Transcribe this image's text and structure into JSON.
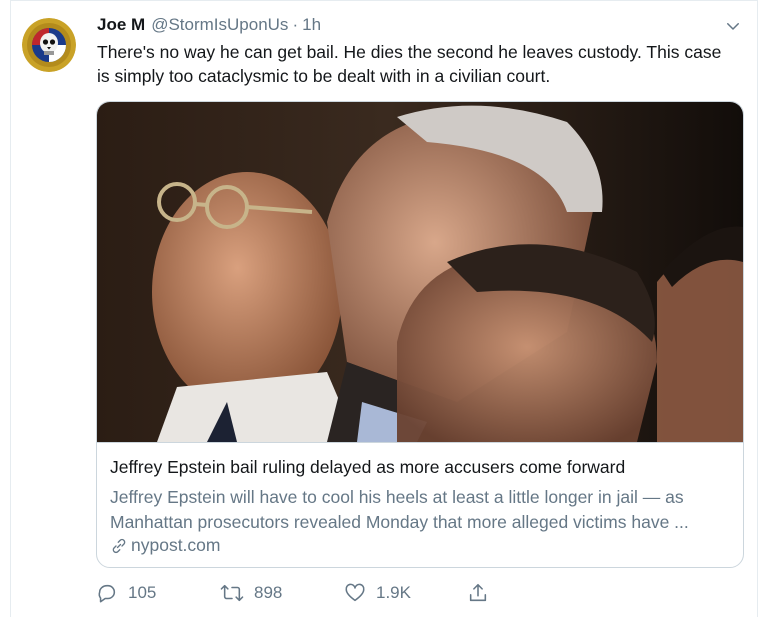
{
  "tweet": {
    "display_name": "Joe M",
    "handle": "@StormIsUponUs",
    "separator": "·",
    "time": "1h",
    "text": "There's no way he can get bail. He dies the second he leaves custody. This case is simply too cataclysmic to be dealt with in a civilian court.",
    "avatar_icon": "skull-emblem-avatar",
    "menu_icon": "chevron-down-icon"
  },
  "link_card": {
    "image_description_icon": "news-photo",
    "title": "Jeffrey Epstein bail ruling delayed as more accusers come forward",
    "description": "Jeffrey Epstein will have to cool his heels at least a little longer in jail — as Manhattan prosecutors revealed Monday that more alleged victims have ...",
    "domain": "nypost.com",
    "link_icon": "link-icon"
  },
  "actions": {
    "reply_count": "105",
    "retweet_count": "898",
    "like_count": "1.9K",
    "reply_icon": "reply-icon",
    "retweet_icon": "retweet-icon",
    "like_icon": "heart-icon",
    "share_icon": "share-icon"
  },
  "colors": {
    "text_primary": "#14171a",
    "text_secondary": "#657786",
    "border": "#ccd6dd"
  }
}
